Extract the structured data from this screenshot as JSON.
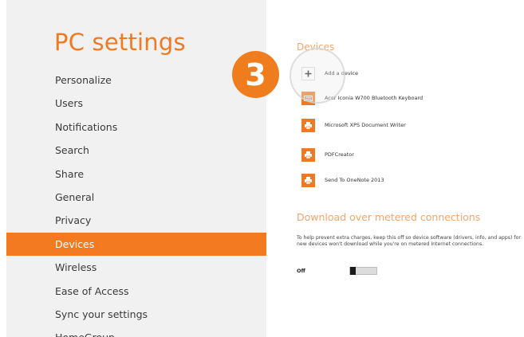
{
  "nav": {
    "title": "PC settings",
    "items": [
      {
        "label": "Personalize"
      },
      {
        "label": "Users"
      },
      {
        "label": "Notifications"
      },
      {
        "label": "Search"
      },
      {
        "label": "Share"
      },
      {
        "label": "General"
      },
      {
        "label": "Privacy"
      },
      {
        "label": "Devices",
        "selected": true
      },
      {
        "label": "Wireless"
      },
      {
        "label": "Ease of Access"
      },
      {
        "label": "Sync your settings"
      },
      {
        "label": "HomeGroup"
      }
    ]
  },
  "devices": {
    "title": "Devices",
    "items": [
      {
        "label": "Add a device",
        "icon": "plus-icon"
      },
      {
        "label": "Acer Iconia W700 Bluetooth Keyboard",
        "icon": "keyboard-icon"
      },
      {
        "label": "Microsoft XPS Document Writer",
        "icon": "printer-icon"
      },
      {
        "label": "PDFCreator",
        "icon": "printer-icon"
      },
      {
        "label": "Send To OneNote 2013",
        "icon": "printer-icon"
      }
    ]
  },
  "metered": {
    "title": "Download over metered connections",
    "description": "To help prevent extra charges, keep this off so device software (drivers, info, and apps) for new devices won't download while you're on metered Internet connections.",
    "toggle_state": "Off"
  },
  "badge": {
    "number": "3"
  },
  "colors": {
    "accent": "#f37a20",
    "nav_bg": "#f1f1f1",
    "section_title": "#f5a56b"
  }
}
